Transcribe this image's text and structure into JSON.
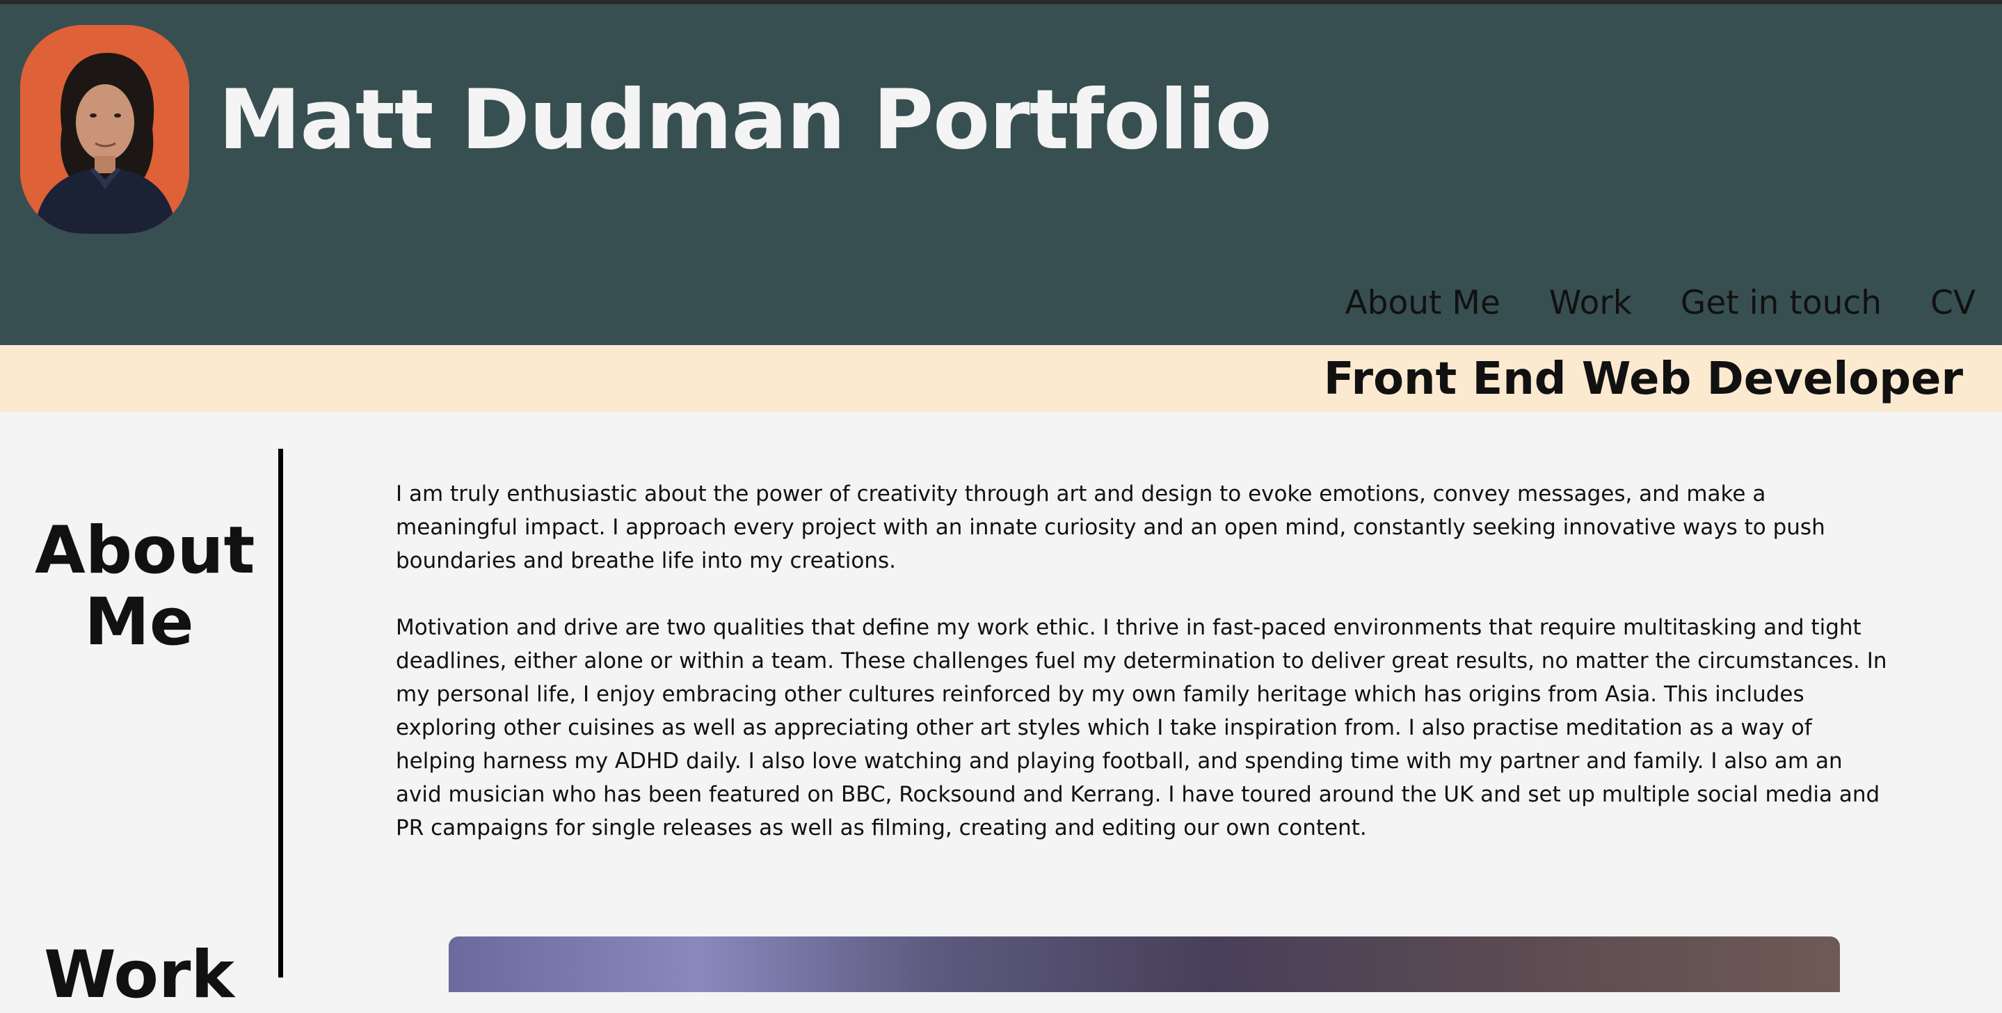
{
  "header": {
    "title": "Matt Dudman Portfolio",
    "bg_color": "#384f52"
  },
  "nav": {
    "items": [
      {
        "label": "About Me"
      },
      {
        "label": "Work"
      },
      {
        "label": "Get in touch"
      },
      {
        "label": "CV"
      }
    ]
  },
  "banner": {
    "text": "Front End Web Developer",
    "bg_color": "#fcead0"
  },
  "about": {
    "heading": "About Me",
    "paragraphs": [
      "I am truly enthusiastic about the power of creativity through art and design to evoke emotions, convey messages, and make a meaningful impact. I approach every project with an innate curiosity and an open mind, constantly seeking innovative ways to push boundaries and breathe life into my creations.",
      "Motivation and drive are two qualities that define my work ethic. I thrive in fast-paced environments that require multitasking and tight deadlines, either alone or within a team. These challenges fuel my determination to deliver great results, no matter the circumstances. In my personal life, I enjoy embracing other cultures reinforced by my own family heritage which has origins from Asia. This includes exploring other cuisines as well as appreciating other art styles which I take inspiration from. I also practise meditation as a way of helping harness my ADHD daily. I also love watching and playing football, and spending time with my partner and family. I also am an avid musician who has been featured on BBC, Rocksound and Kerrang. I have toured around the UK and set up multiple social media and PR campaigns for single releases as well as filming, creating and editing our own content."
    ]
  },
  "work": {
    "heading": "Work"
  }
}
